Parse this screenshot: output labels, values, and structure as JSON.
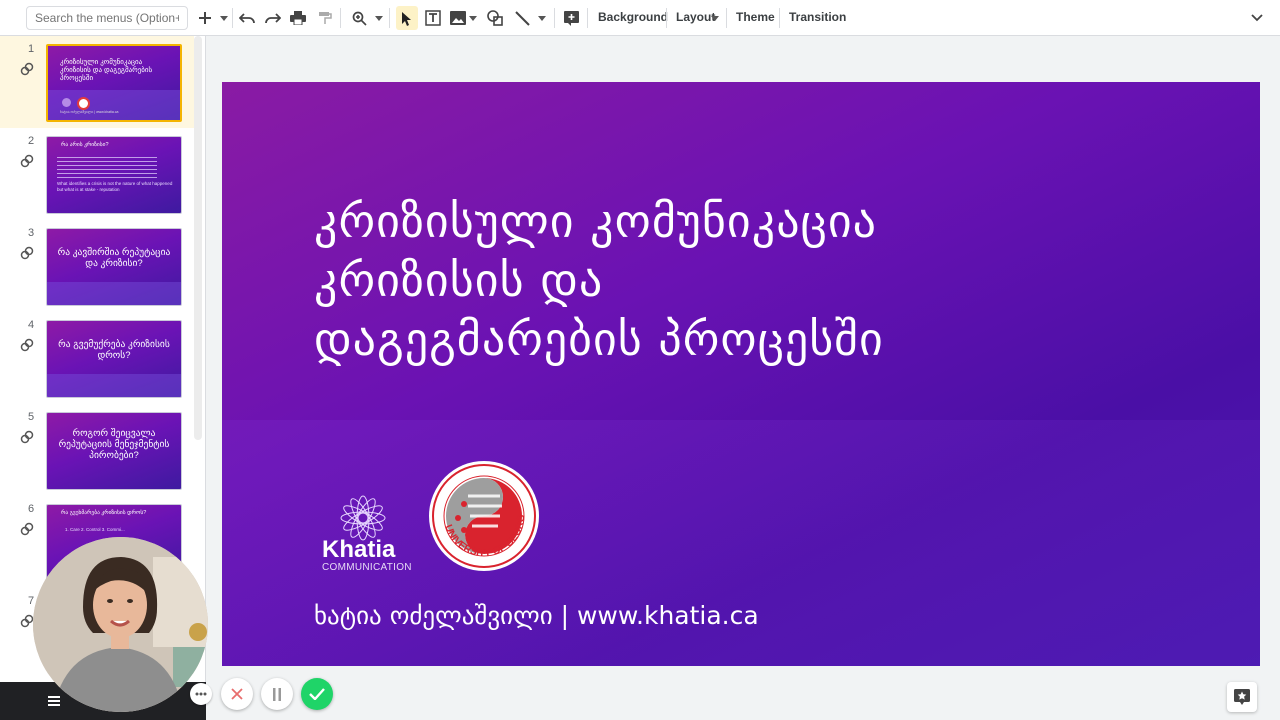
{
  "toolbar": {
    "search_placeholder": "Search the menus (Option+/)",
    "background_label": "Background",
    "layout_label": "Layout",
    "theme_label": "Theme",
    "transition_label": "Transition"
  },
  "slides": [
    {
      "num": "1",
      "title": "კრიზისული კომუნიკაცია კრიზისის და დაგეგმარების პროცესში",
      "footer": "ხატია ოძელაშვილი | www.khatia.ca"
    },
    {
      "num": "2",
      "title": "რა არის კრიზისი?",
      "body": "What identifies a crisis is not the nature of what happened but what is at stake - reputation"
    },
    {
      "num": "3",
      "title": "რა კავშირშია რეპუტაცია და კრიზისი?"
    },
    {
      "num": "4",
      "title": "რა გვემუქრება კრიზისის დროს?"
    },
    {
      "num": "5",
      "title": "როგორ შეიცვალა რეპუტაციის მენეჯმენტის პირობები?"
    },
    {
      "num": "6",
      "title": "რა გვეხმარება კრიზისის დროს?",
      "body": "1. Care 2. Control 3. Commi..."
    },
    {
      "num": "7"
    }
  ],
  "main_slide": {
    "title_line1": "კრიზისული კომუნიკაცია",
    "title_line2": "კრიზისის და",
    "title_line3": "დაგეგმარების პროცესში",
    "footer": "ხატია ოძელაშვილი | www.khatia.ca",
    "logo_name": "Khatia",
    "logo_sub": "COMMUNICATION",
    "ug_text": "UNIVERSITY OF GEORGIA"
  },
  "colors": {
    "accent": "#f4b400",
    "slide_purple": "#6a12b3",
    "confirm_green": "#1fd468",
    "cancel_red": "#e86d6d"
  }
}
